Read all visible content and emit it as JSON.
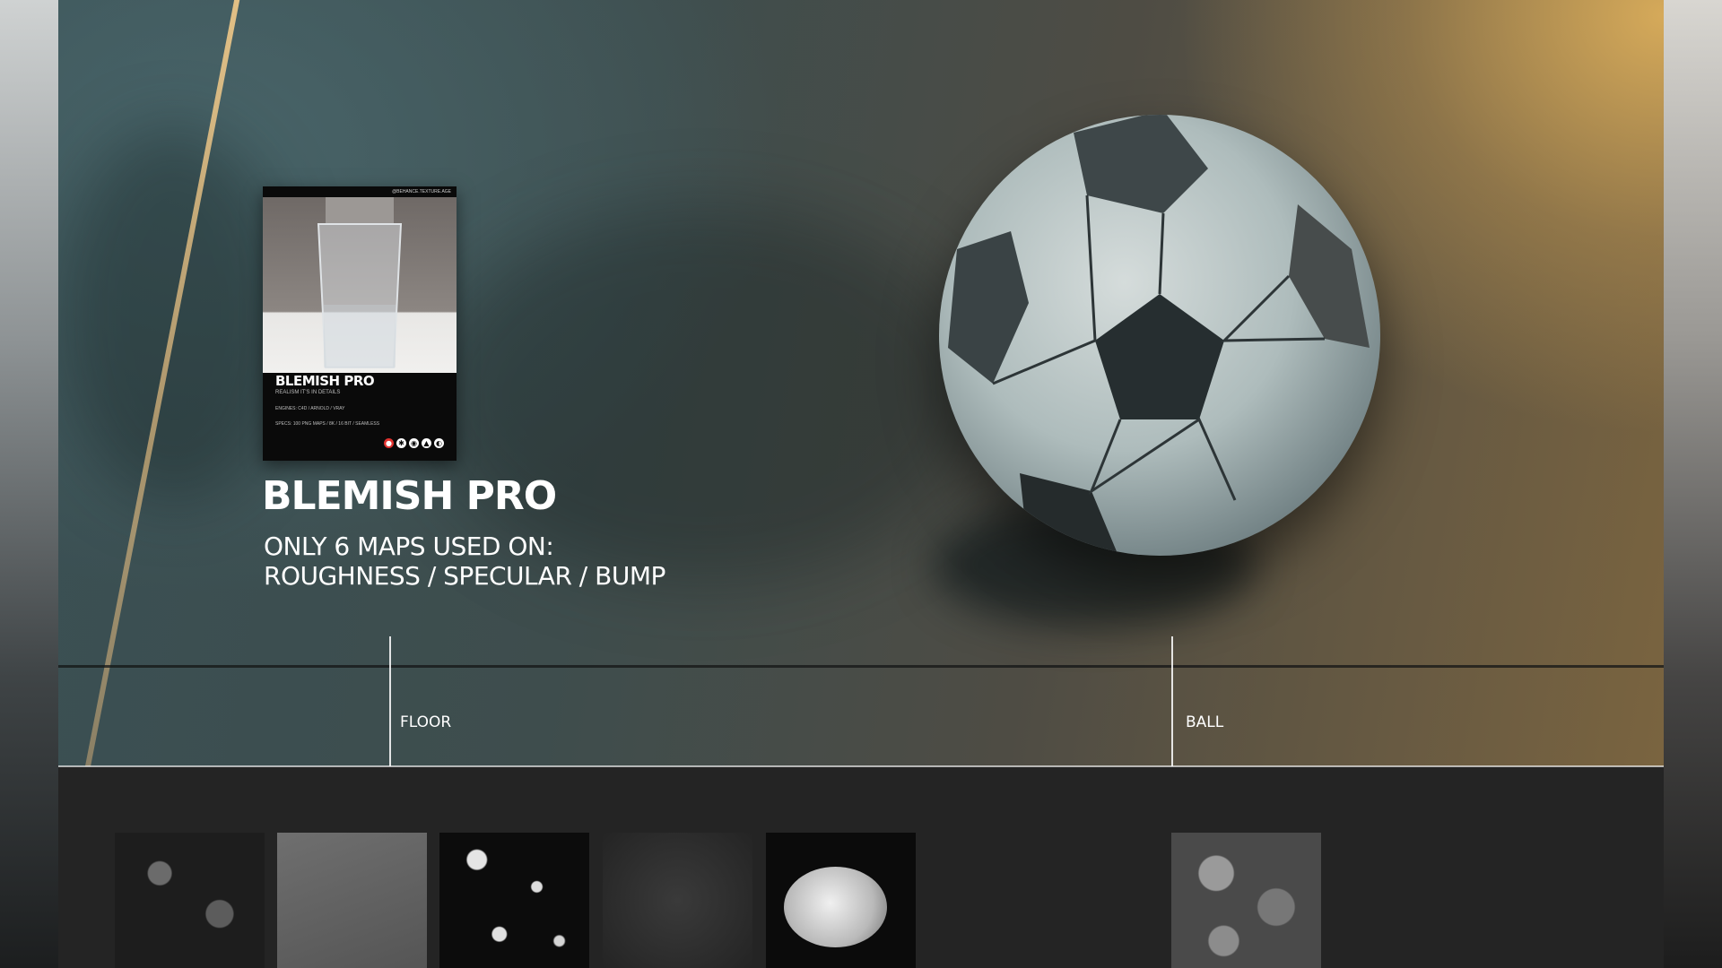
{
  "poster": {
    "top_text": "@BEHANCE.TEXTURE.AGE",
    "title": "BLEMISH PRO",
    "subtitle": "REALISM IT'S IN DETAILS",
    "engines_label": "ENGINES:",
    "engines_value": "C4D / ARNOLD / VRAY",
    "specs_label": "SPECS:",
    "specs_value": "100 PNG MAPS / 8K / 16 BIT / SEAMLESS",
    "icon_names": [
      "redshift-icon",
      "octane-icon",
      "arnold-icon",
      "vray-icon",
      "corona-icon"
    ]
  },
  "hero": {
    "title": "BLEMISH PRO",
    "desc_line1": "ONLY 6 MAPS USED ON:",
    "desc_line2": "ROUGHNESS / SPECULAR / BUMP"
  },
  "labels": {
    "floor": "FLOOR",
    "ball": "BALL"
  },
  "colors": {
    "background": "#242424",
    "accent_gold": "#deb05c",
    "accent_teal": "#4a676c"
  }
}
